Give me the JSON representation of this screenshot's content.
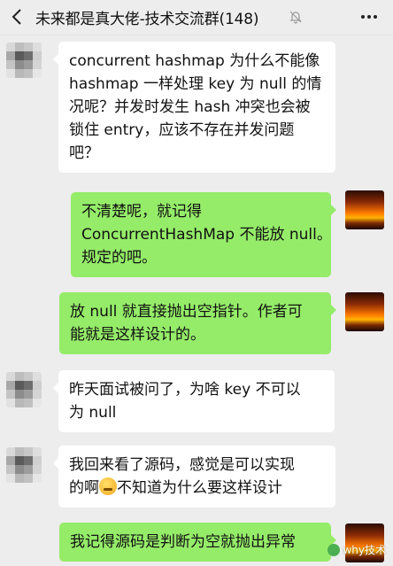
{
  "header": {
    "title": "未来都是真大佬-技术交流群(148)",
    "back_icon": "back-arrow-icon",
    "mute_icon": "bell-muted-icon",
    "more_icon": "more-dots-icon"
  },
  "messages": [
    {
      "side": "left",
      "lines": [
        "concurrent hashmap 为什么不能像",
        "hashmap 一样处理 key 为 null 的情",
        "况呢？并发时发生 hash 冲突也会被",
        "锁住 entry，应该不存在并发问题",
        "吧？"
      ]
    },
    {
      "side": "right",
      "lines": [
        "不清楚呢，就记得",
        "ConcurrentHashMap 不能放 null。",
        "规定的吧。"
      ]
    },
    {
      "side": "right",
      "lines": [
        "放 null 就直接抛出空指针。作者可",
        "能就是这样设计的。"
      ]
    },
    {
      "side": "left",
      "lines": [
        "昨天面试被问了，为啥 key 不可以",
        "为 null"
      ]
    },
    {
      "side": "left",
      "lines": [
        "我回来看了源码，感觉是可以实现"
      ],
      "line2_before_emoji": "的啊",
      "line2_after_emoji": "不知道为什么要这样设计"
    },
    {
      "side": "right",
      "lines": [
        "我记得源码是判断为空就抛出异常"
      ]
    }
  ],
  "watermark": "why技术",
  "colors": {
    "background": "#ededed",
    "left_bubble": "#ffffff",
    "right_bubble": "#95ec69"
  }
}
